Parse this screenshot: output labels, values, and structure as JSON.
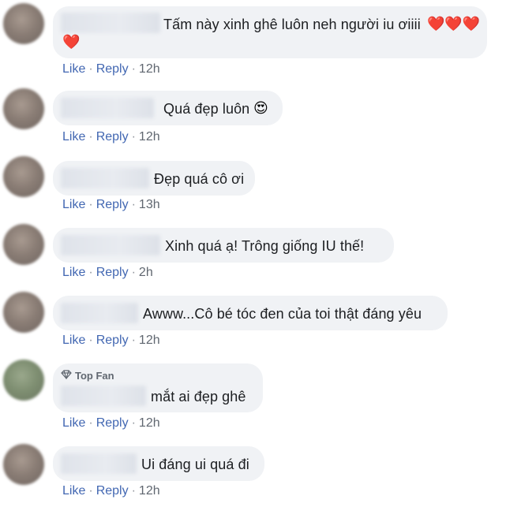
{
  "comments": [
    {
      "text": "Tấm này xinh ghê luôn neh người iu ơiiii",
      "emoji": "❤️❤️❤️",
      "emoji2": "❤️",
      "like": "Like",
      "reply": "Reply",
      "time": "12h"
    },
    {
      "text": "Quá đẹp luôn",
      "emoji": "😍",
      "like": "Like",
      "reply": "Reply",
      "time": "12h"
    },
    {
      "text": "Đẹp quá cô ơi",
      "like": "Like",
      "reply": "Reply",
      "time": "13h"
    },
    {
      "text": "Xinh quá ạ! Trông giống IU thế!",
      "like": "Like",
      "reply": "Reply",
      "time": "2h"
    },
    {
      "text": "Awww...Cô bé tóc đen của toi thật đáng yêu",
      "like": "Like",
      "reply": "Reply",
      "time": "12h"
    },
    {
      "badge": "Top Fan",
      "text": "mắt ai đẹp ghê",
      "like": "Like",
      "reply": "Reply",
      "time": "12h"
    },
    {
      "text": "Ui đáng ui quá đi",
      "like": "Like",
      "reply": "Reply",
      "time": "12h"
    }
  ],
  "icons": {
    "badge": "diamond-icon",
    "heart": "heart-icon",
    "emoji": "heart-eyes-emoji"
  },
  "colors": {
    "link": "#4267b2",
    "bubble": "#f0f2f5",
    "text": "#1c1e21"
  }
}
